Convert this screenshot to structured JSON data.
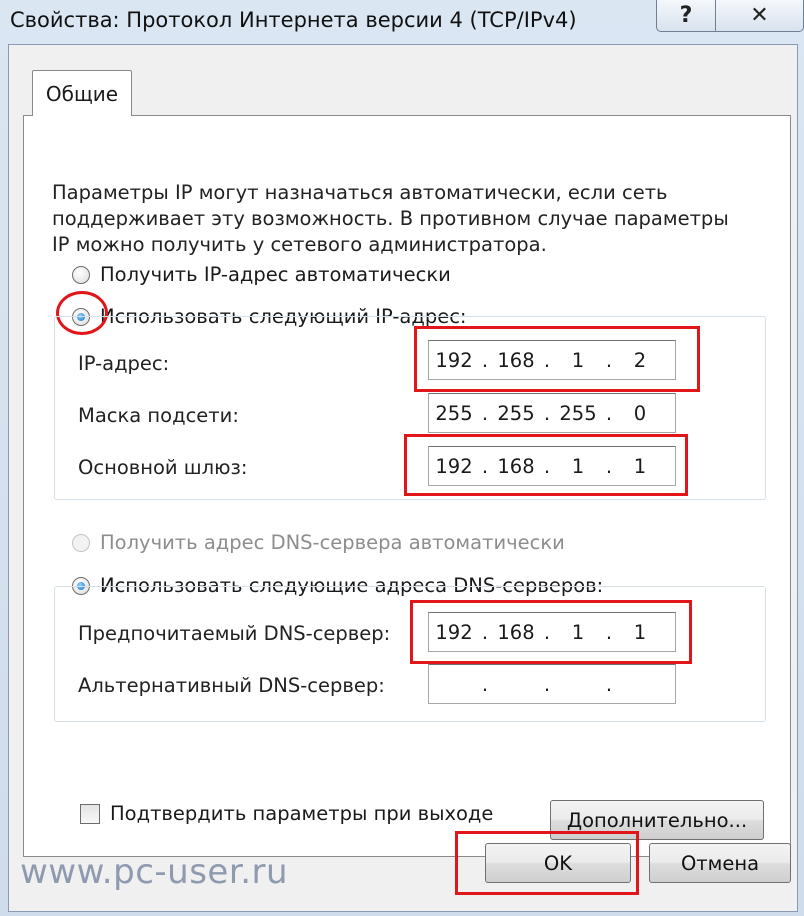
{
  "window": {
    "title": "Свойства: Протокол Интернета версии 4 (TCP/IPv4)",
    "help_label": "?",
    "close_label": "✕"
  },
  "tab": {
    "label": "Общие"
  },
  "description": "Параметры IP могут назначаться автоматически, если сеть поддерживает эту возможность. В противном случае параметры IP можно получить у сетевого администратора.",
  "ip": {
    "auto_label": "Получить IP-адрес автоматически",
    "manual_label": "Использовать следующий IP-адрес:",
    "selected": "manual",
    "fields": [
      {
        "label": "IP-адрес:",
        "octets": [
          "192",
          "168",
          "1",
          "2"
        ]
      },
      {
        "label": "Маска подсети:",
        "octets": [
          "255",
          "255",
          "255",
          "0"
        ]
      },
      {
        "label": "Основной шлюз:",
        "octets": [
          "192",
          "168",
          "1",
          "1"
        ]
      }
    ]
  },
  "dns": {
    "auto_label": "Получить адрес DNS-сервера автоматически",
    "manual_label": "Использовать следующие адреса DNS-серверов:",
    "selected": "manual",
    "fields": [
      {
        "label": "Предпочитаемый DNS-сервер:",
        "octets": [
          "192",
          "168",
          "1",
          "1"
        ]
      },
      {
        "label": "Альтернативный DNS-сервер:",
        "octets": [
          "",
          "",
          "",
          ""
        ]
      }
    ]
  },
  "validate_label": "Подтвердить параметры при выходе",
  "validate_checked": false,
  "buttons": {
    "advanced": "Дополнительно...",
    "ok": "OK",
    "cancel": "Отмена"
  },
  "watermark": "www.pc-user.ru",
  "colors": {
    "highlight": "#e0161b",
    "accent": "#1670c2"
  }
}
